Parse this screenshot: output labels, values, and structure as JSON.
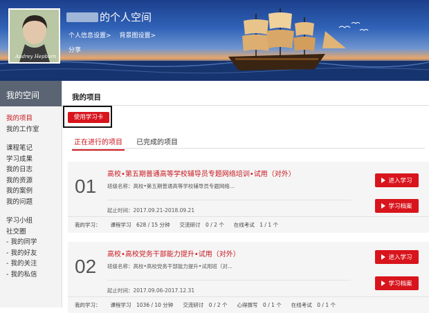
{
  "header": {
    "name_suffix": "的个人空间",
    "links": [
      "个人信息设置>",
      "背景图设置>"
    ],
    "share": "分享",
    "avatar_signature": "Audrey Hepburn"
  },
  "sidebar": {
    "title": "我的空间",
    "groups": [
      [
        "我的项目",
        "我的工作室"
      ],
      [
        "课程笔记",
        "学习成果",
        "我的日志",
        "我的资源",
        "我的案例",
        "我的问题"
      ],
      [
        "学习小组",
        "社交圈",
        "- 我的同学",
        "- 我的好友",
        "- 我的关注",
        "- 我的私信"
      ]
    ]
  },
  "main": {
    "title": "我的项目",
    "card_button": "使用学习卡",
    "tabs": [
      "正在进行的项目",
      "已完成的项目"
    ]
  },
  "projects": [
    {
      "num": "01",
      "title": "高校•第五期普通高等学校辅导员专题网络培训•试用（对外）",
      "class": "班级名称：高校•第五期普通高等学校辅导员专题网络...",
      "date": "起止时间：2017.09.21-2018.09.21",
      "stats": [
        "我的学习：",
        "课程学习　628 / 15 分钟",
        "交流研讨　0 / 2 个",
        "在线考试　1 / 1 个"
      ],
      "btn_enter": "进入学习",
      "btn_archive": "学习档案"
    },
    {
      "num": "02",
      "title": "高校•高校党务干部能力提升•试用（对外）",
      "class": "班级名称：高校•高校党务干部能力提升•试用班（对...",
      "date": "起止时间：2017.09.06-2017.12.31",
      "stats": [
        "我的学习：",
        "课程学习　1036 / 10 分钟",
        "交流研讨　0 / 2 个",
        "心得撰写　0 / 1 个",
        "在线考试　0 / 1 个"
      ],
      "btn_enter": "进入学习",
      "btn_archive": "学习档案"
    }
  ],
  "colors": {
    "accent": "#d8141c",
    "sidebar_title_bg": "#5b6473"
  }
}
